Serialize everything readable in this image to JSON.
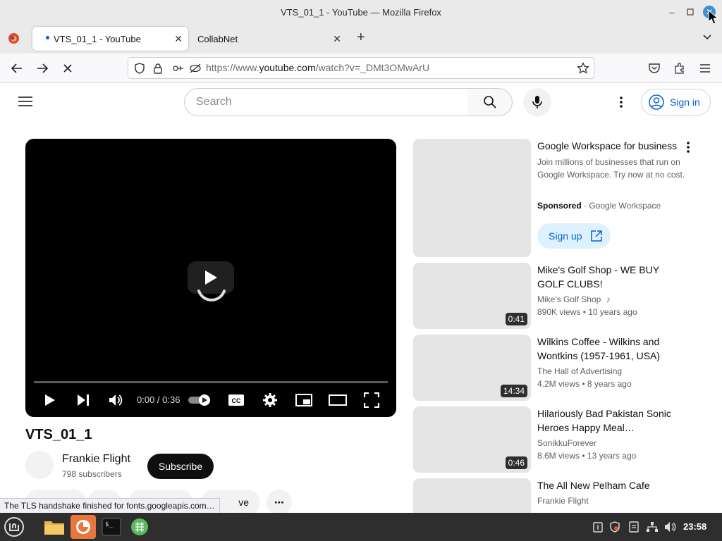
{
  "window": {
    "title": "VTS_01_1 - YouTube — Mozilla Firefox"
  },
  "tabs": [
    {
      "label": "VTS_01_1 - YouTube",
      "active": true
    },
    {
      "label": "CollabNet",
      "active": false
    }
  ],
  "nav": {
    "url_prefix": "https://www.",
    "url_host": "youtube.com",
    "url_path": "/watch?v=_DMt3OMwArU"
  },
  "youtube": {
    "search_placeholder": "Search",
    "sign_in_label": "Sign in",
    "video": {
      "title": "VTS_01_1",
      "time": "0:00 / 0:36",
      "progress": 0.0
    },
    "channel": {
      "name": "Frankie Flight",
      "subscribers": "798 subscribers",
      "subscribe_label": "Subscribe"
    },
    "actions": {
      "save_partial": "ve",
      "more": "⋯"
    },
    "ad": {
      "title": "Google Workspace for business",
      "description": "Join millions of businesses that run on Google Workspace. Try now at no cost.",
      "sponsored": "Sponsored",
      "advertiser": "· Google Workspace",
      "cta": "Sign up"
    },
    "recommendations": [
      {
        "title": "Mike's Golf Shop - WE BUY GOLF CLUBS!",
        "channel": "Mike's Golf Shop",
        "music_note": true,
        "views": "890K views",
        "age": "• 10 years ago",
        "duration": "0:41"
      },
      {
        "title": "Wilkins Coffee - Wilkins and Wontkins (1957-1961, USA)",
        "channel": "The Hall of Advertising",
        "views": "4.2M views",
        "age": "• 8 years ago",
        "duration": "14:34"
      },
      {
        "title": "Hilariously Bad Pakistan Sonic Heroes Happy Meal…",
        "channel": "SonikkuForever",
        "views": "8.6M views",
        "age": "• 13 years ago",
        "duration": "0:46"
      },
      {
        "title": "The All New Pelham Cafe",
        "channel": "Frankie Flight"
      }
    ]
  },
  "status_text": "The TLS handshake finished for fonts.googleapis.com…",
  "taskbar": {
    "clock": "23:58"
  },
  "colors": {
    "accent_blue": "#065fd4",
    "firefox_dot": "#0060df"
  }
}
